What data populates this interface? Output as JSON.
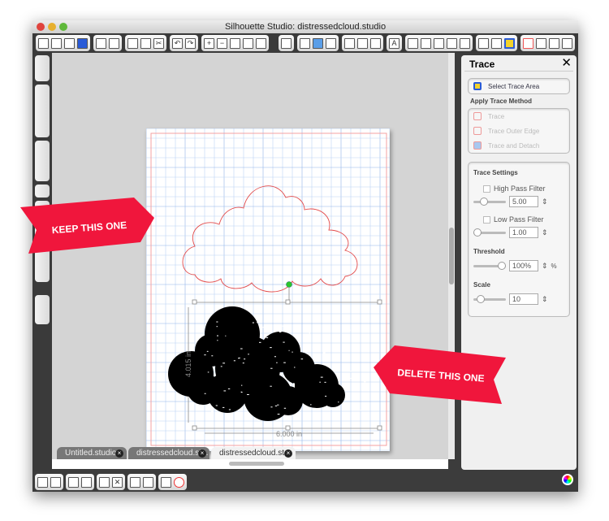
{
  "window": {
    "title": "Silhouette Studio: distressedcloud.studio"
  },
  "tabs": [
    {
      "label": "Untitled.studio",
      "active": false
    },
    {
      "label": "distressedcloud.st...",
      "active": false
    },
    {
      "label": "distressedcloud.st...",
      "active": true
    }
  ],
  "canvas": {
    "width_label": "6.000 in",
    "height_label": "4.015 in"
  },
  "annotations": {
    "keep": "KEEP THIS ONE",
    "delete": "DELETE THIS ONE",
    "ribbon_color": "#f0163c"
  },
  "trace_panel": {
    "title": "Trace",
    "select_area": "Select Trace Area",
    "apply_method_label": "Apply Trace Method",
    "methods": [
      "Trace",
      "Trace Outer Edge",
      "Trace and Detach"
    ],
    "settings_label": "Trace Settings",
    "high_pass": {
      "label": "High Pass Filter",
      "checked": false,
      "value": "5.00"
    },
    "low_pass": {
      "label": "Low Pass Filter",
      "checked": false,
      "value": "1.00"
    },
    "threshold": {
      "label": "Threshold",
      "value": "100%",
      "unit": "%"
    },
    "scale": {
      "label": "Scale",
      "value": "10"
    }
  }
}
